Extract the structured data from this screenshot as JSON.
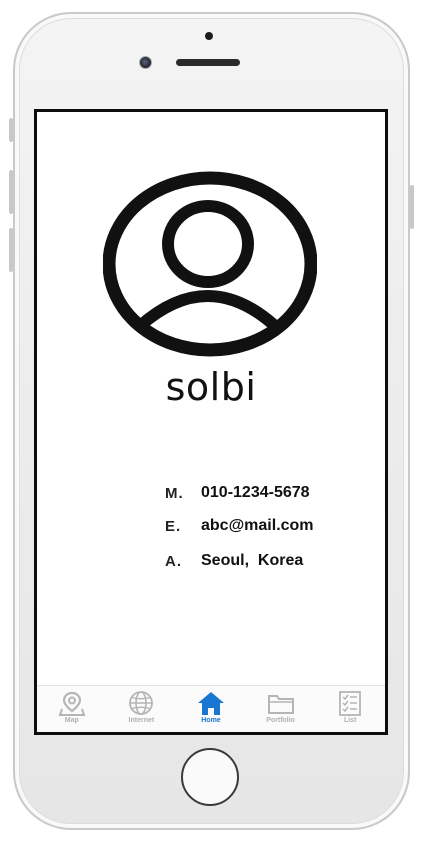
{
  "profile": {
    "name": "solbi"
  },
  "contact": [
    {
      "key": "M.",
      "value": "010-1234-5678"
    },
    {
      "key": "E.",
      "value": "abc@mail.com"
    },
    {
      "key": "A.",
      "value": "Seoul,  Korea"
    }
  ],
  "tabbar": {
    "items": [
      {
        "label": "Map",
        "icon": "map-pin-icon"
      },
      {
        "label": "Internet",
        "icon": "globe-icon"
      },
      {
        "label": "Home",
        "icon": "home-icon",
        "active": true
      },
      {
        "label": "Portfolio",
        "icon": "folder-icon"
      },
      {
        "label": "List",
        "icon": "checklist-icon"
      }
    ]
  },
  "colors": {
    "accent": "#1976d2",
    "inactive": "#b0b0b0",
    "text": "#111111"
  }
}
